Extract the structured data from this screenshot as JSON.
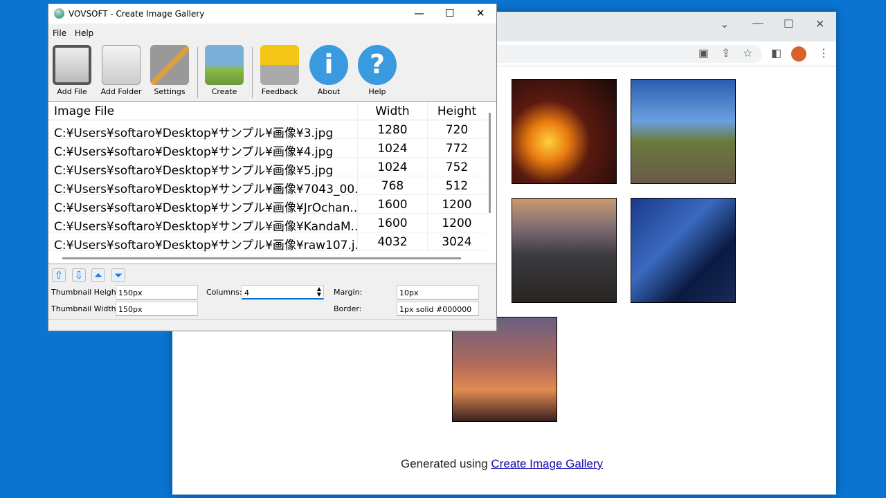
{
  "browser": {
    "footer_text": "Generated using ",
    "footer_link": "Create Image Gallery"
  },
  "app": {
    "title": "VOVSOFT - Create Image Gallery",
    "menu": [
      "File",
      "Help"
    ],
    "toolbar": [
      "Add File",
      "Add Folder",
      "Settings",
      "Create",
      "Feedback",
      "About",
      "Help"
    ],
    "table": {
      "headers": [
        "Image File",
        "Width",
        "Height"
      ],
      "rows": [
        [
          "C:¥Users¥softaro¥Desktop¥サンプル¥画像¥3.jpg",
          "1280",
          "720"
        ],
        [
          "C:¥Users¥softaro¥Desktop¥サンプル¥画像¥4.jpg",
          "1024",
          "772"
        ],
        [
          "C:¥Users¥softaro¥Desktop¥サンプル¥画像¥5.jpg",
          "1024",
          "752"
        ],
        [
          "C:¥Users¥softaro¥Desktop¥サンプル¥画像¥7043_00...",
          "768",
          "512"
        ],
        [
          "C:¥Users¥softaro¥Desktop¥サンプル¥画像¥JrOchan...",
          "1600",
          "1200"
        ],
        [
          "C:¥Users¥softaro¥Desktop¥サンプル¥画像¥KandaM...",
          "1600",
          "1200"
        ],
        [
          "C:¥Users¥softaro¥Desktop¥サンプル¥画像¥raw107.j...",
          "4032",
          "3024"
        ]
      ]
    },
    "settings": {
      "thumb_height_label": "Thumbnail Height:",
      "thumb_height": "150px",
      "thumb_width_label": "Thumbnail Width:",
      "thumb_width": "150px",
      "columns_label": "Columns:",
      "columns": "4",
      "margin_label": "Margin:",
      "margin": "10px",
      "border_label": "Border:",
      "border": "1px solid #000000"
    }
  }
}
